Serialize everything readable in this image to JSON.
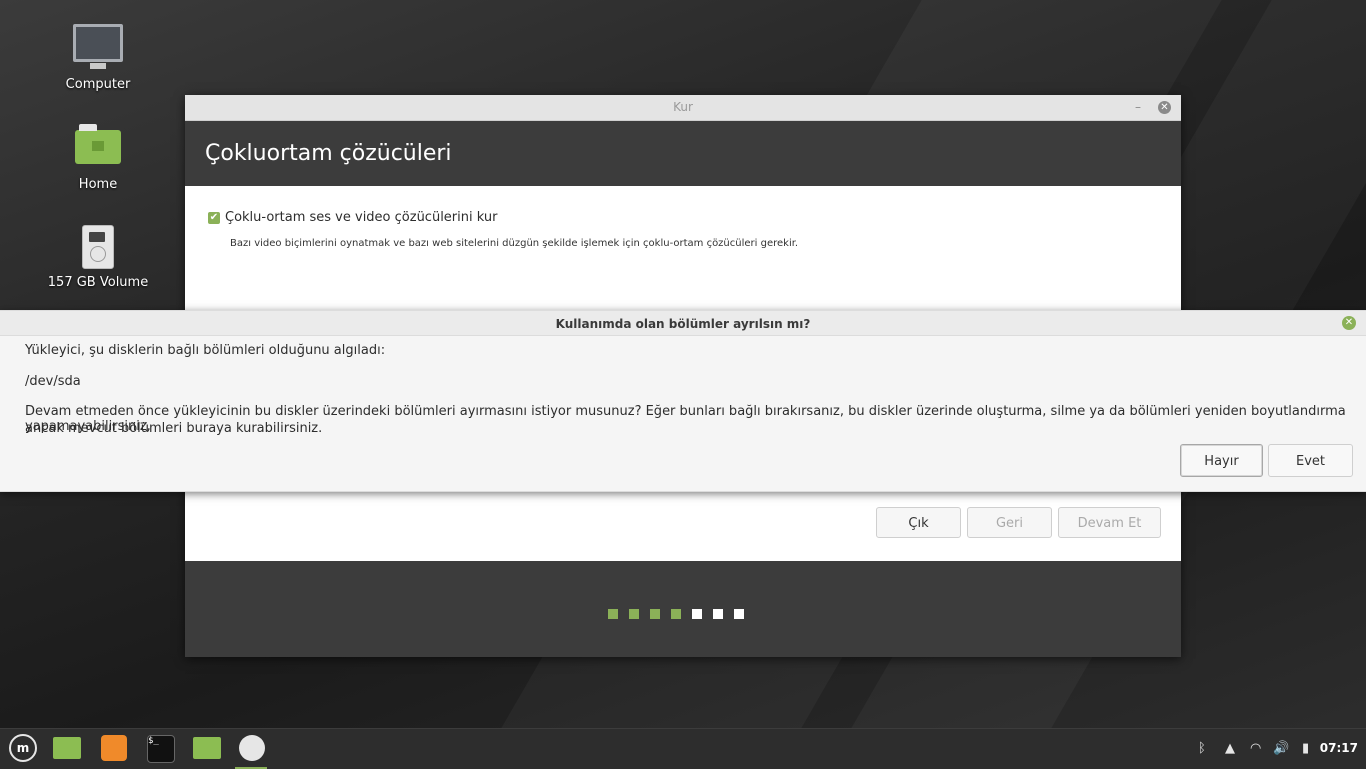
{
  "desktop": {
    "icons": [
      {
        "label": "Computer",
        "icon": "computer-icon"
      },
      {
        "label": "Home",
        "icon": "home-folder-icon"
      },
      {
        "label": "157 GB Volume",
        "icon": "drive-icon"
      }
    ]
  },
  "installer": {
    "window_title": "Kur",
    "minimize_glyph": "–",
    "close_glyph": "✕",
    "page_title": "Çokluortam çözücüleri",
    "checkbox_label": "Çoklu-ortam ses ve video çözücülerini kur",
    "checkbox_checked": true,
    "checkbox_description": "Bazı video biçimlerini oynatmak ve bazı web sitelerini düzgün şekilde işlemek için çoklu-ortam çözücüleri gerekir.",
    "buttons": {
      "quit": "Çık",
      "back": "Geri",
      "continue": "Devam Et"
    },
    "progress": {
      "total_steps": 7,
      "completed_steps": 4
    },
    "colors": {
      "accent": "#8bb158",
      "header_bg": "#3c3c3c"
    }
  },
  "dialog": {
    "title": "Kullanımda olan bölümler ayrılsın mı?",
    "line1": "Yükleyici, şu disklerin bağlı bölümleri olduğunu algıladı:",
    "device": "/dev/sda",
    "line2a": "Devam etmeden önce yükleyicinin bu diskler üzerindeki bölümleri ayırmasını istiyor musunuz? Eğer bunları bağlı bırakırsanız, bu diskler üzerinde oluşturma, silme ya da bölümleri yeniden boyutlandırma yapamayabilirsiniz,",
    "line2b": "ancak mevcut bölümleri buraya kurabilirsiniz.",
    "no_label": "Hayır",
    "yes_label": "Evet"
  },
  "taskbar": {
    "items": [
      "mint-menu-icon",
      "show-desktop-icon",
      "firefox-icon",
      "terminal-icon",
      "files-icon",
      "installer-disc-icon"
    ],
    "terminal_glyph": "$_",
    "tray": {
      "bluetooth": "ᛒ",
      "updates": "▲",
      "wifi": "◠",
      "volume": "🔊",
      "battery": "▮"
    },
    "clock": "07:17"
  }
}
